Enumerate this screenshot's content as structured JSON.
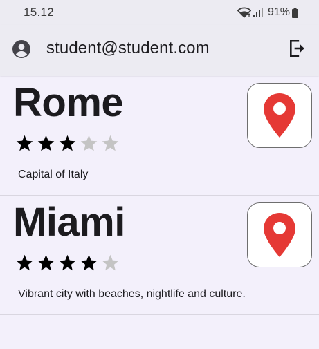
{
  "status_bar": {
    "time": "15.12",
    "battery": "91%"
  },
  "app_bar": {
    "user_email": "student@student.com",
    "icons": {
      "account": "account-circle-icon",
      "logout": "logout-icon"
    }
  },
  "places": [
    {
      "title": "Rome",
      "rating": 3,
      "max_rating": 5,
      "description": "Capital of Italy",
      "map_icon": "map-pin-icon"
    },
    {
      "title": "Miami",
      "rating": 4,
      "max_rating": 5,
      "description": "Vibrant city with beaches, nightlife and culture.",
      "map_icon": "map-pin-icon"
    }
  ],
  "colors": {
    "background": "#f3f0fb",
    "app_bar": "#ecebf2",
    "star_filled": "#000000",
    "star_empty": "#c4c4c4",
    "pin": "#e53935"
  }
}
